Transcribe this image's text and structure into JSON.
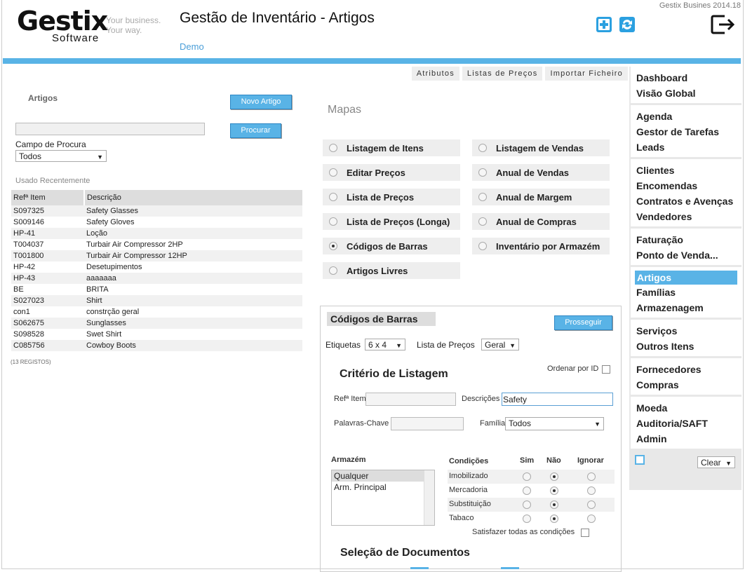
{
  "header": {
    "version": "Gestix Busines 2014.18",
    "logo_main": "Gestix",
    "logo_sub": "Software",
    "logo_tagline_1": "Your business.",
    "logo_tagline_2": "Your way.",
    "title": "Gestão de Inventário - Artigos",
    "company": "Demo"
  },
  "tabs": [
    "Atributos",
    "Listas de Preços",
    "Importar Ficheiro"
  ],
  "left": {
    "section_label": "Artigos",
    "new_button": "Novo Artigo",
    "search_button": "Procurar",
    "search_value": "",
    "field_label": "Campo de Procura",
    "field_value": "Todos",
    "recent_label": "Usado Recentemente",
    "columns": [
      "Refª Item",
      "Descrição"
    ],
    "rows": [
      [
        "S097325",
        "Safety Glasses"
      ],
      [
        "S009146",
        "Safety Gloves"
      ],
      [
        "HP-41",
        "Loção"
      ],
      [
        "T004037",
        "Turbair Air Compressor 2HP"
      ],
      [
        "T001800",
        "Turbair Air Compressor 12HP"
      ],
      [
        "HP-42",
        "Desetupimentos"
      ],
      [
        "HP-43",
        "aaaaaaa"
      ],
      [
        "BE",
        "BRITA"
      ],
      [
        "S027023",
        "Shirt"
      ],
      [
        "con1",
        "constrção geral"
      ],
      [
        "S062675",
        "Sunglasses"
      ],
      [
        "S098528",
        "Swet Shirt"
      ],
      [
        "C085756",
        "Cowboy Boots"
      ]
    ],
    "count": "(13 REGISTOS)"
  },
  "mapas": {
    "title": "Mapas",
    "items_left": [
      "Listagem de Itens",
      "Editar Preços",
      "Lista de Preços",
      "Lista de Preços (Longa)",
      "Códigos de Barras",
      "Artigos Livres"
    ],
    "items_right": [
      "Listagem de Vendas",
      "Anual de Vendas",
      "Anual de Margem",
      "Anual de Compras",
      "Inventário por Armazém"
    ],
    "selected": "Códigos de Barras"
  },
  "panel": {
    "title": "Códigos de Barras",
    "proceed_button": "Prosseguir",
    "labels_label": "Etiquetas",
    "labels_value": "6 x 4",
    "pricelist_label": "Lista de Preços",
    "pricelist_value": "Geral",
    "criteria_title": "Critério de Listagem",
    "order_by_id": "Ordenar por ID",
    "ref_label": "Refª Item",
    "ref_value": "",
    "desc_label": "Descrições",
    "desc_value": "Safety",
    "keywords_label": "Palavras-Chave",
    "keywords_value": "",
    "family_label": "Família",
    "family_value": "Todos",
    "warehouse_label": "Armazém",
    "warehouses": [
      "Qualquer",
      "Arm. Principal"
    ],
    "conditions_label": "Condições",
    "col_yes": "Sim",
    "col_no": "Não",
    "col_ignore": "Ignorar",
    "conditions": [
      "Imobilizado",
      "Mercadoria",
      "Substituição",
      "Tabaco"
    ],
    "satisfy_all": "Satisfazer todas as condições",
    "docs_title": "Seleção de Documentos"
  },
  "sidebar": {
    "groups": [
      [
        "Dashboard",
        "Visão Global"
      ],
      [
        "Agenda",
        "Gestor de Tarefas",
        "Leads"
      ],
      [
        "Clientes",
        "Encomendas",
        "Contratos e Avenças",
        "Vendedores"
      ],
      [
        "Faturação",
        "Ponto de Venda..."
      ],
      [
        "Artigos",
        "Famílias",
        "Armazenagem"
      ],
      [
        "Serviços",
        "Outros Itens"
      ],
      [
        "Fornecedores",
        "Compras"
      ],
      [
        "Moeda",
        "Auditoria/SAFT",
        "Admin"
      ]
    ],
    "active": "Artigos",
    "clear_label": "Clear"
  },
  "colors": {
    "accent": "#59b3e6"
  }
}
